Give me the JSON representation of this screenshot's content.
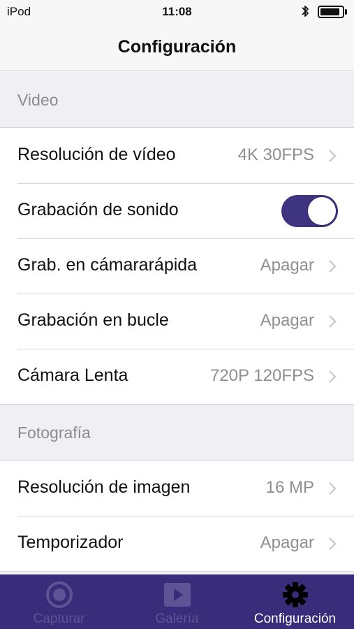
{
  "status_bar": {
    "carrier": "iPod",
    "time": "11:08",
    "battery_level": 0.9
  },
  "nav": {
    "title": "Configuración"
  },
  "sections": {
    "video": {
      "header": "Video",
      "rows": [
        {
          "label": "Resolución de vídeo",
          "value": "4K 30FPS"
        },
        {
          "label": "Grabación de sonido",
          "toggle_on": true
        },
        {
          "label": "Grab. en cámararápida",
          "value": "Apagar"
        },
        {
          "label": "Grabación en bucle",
          "value": "Apagar"
        },
        {
          "label": "Cámara Lenta",
          "value": "720P 120FPS"
        }
      ]
    },
    "photo": {
      "header": "Fotografía",
      "rows": [
        {
          "label": "Resolución de imagen",
          "value": "16 MP"
        },
        {
          "label": "Temporizador",
          "value": "Apagar"
        }
      ]
    }
  },
  "tabs": [
    {
      "label": "Capturar",
      "icon": "camera-icon",
      "active": false
    },
    {
      "label": "Galería",
      "icon": "play-icon",
      "active": false
    },
    {
      "label": "Configuración",
      "icon": "gear-icon",
      "active": true
    }
  ],
  "colors": {
    "accent": "#3f3480",
    "tab_bar": "#392c7a",
    "tab_inactive": "#5e5395",
    "tab_active": "#ffffff"
  }
}
